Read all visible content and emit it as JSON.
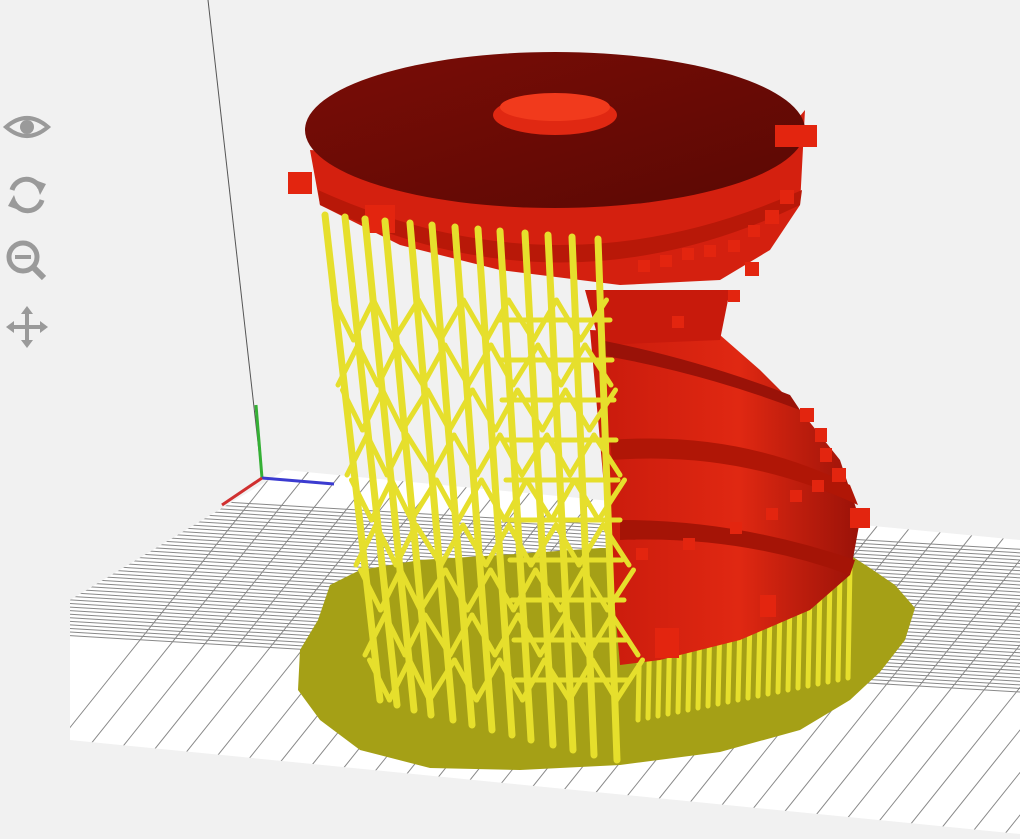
{
  "viewer": {
    "background_color": "#f1f1f1",
    "model_color": "#d4200f",
    "support_color": "#e6df2c",
    "raft_color": "#a5a016",
    "grid_color": "#888888",
    "axes": {
      "x_color": "#3b3bd0",
      "y_color": "#35b035",
      "z_color": "#d03030"
    }
  },
  "toolbar": {
    "tools": [
      {
        "name": "view",
        "icon": "eye-icon"
      },
      {
        "name": "rotate",
        "icon": "rotate-icon"
      },
      {
        "name": "zoom",
        "icon": "zoom-icon"
      },
      {
        "name": "pan",
        "icon": "move-icon"
      }
    ],
    "icon_color": "#9a9a9a"
  }
}
